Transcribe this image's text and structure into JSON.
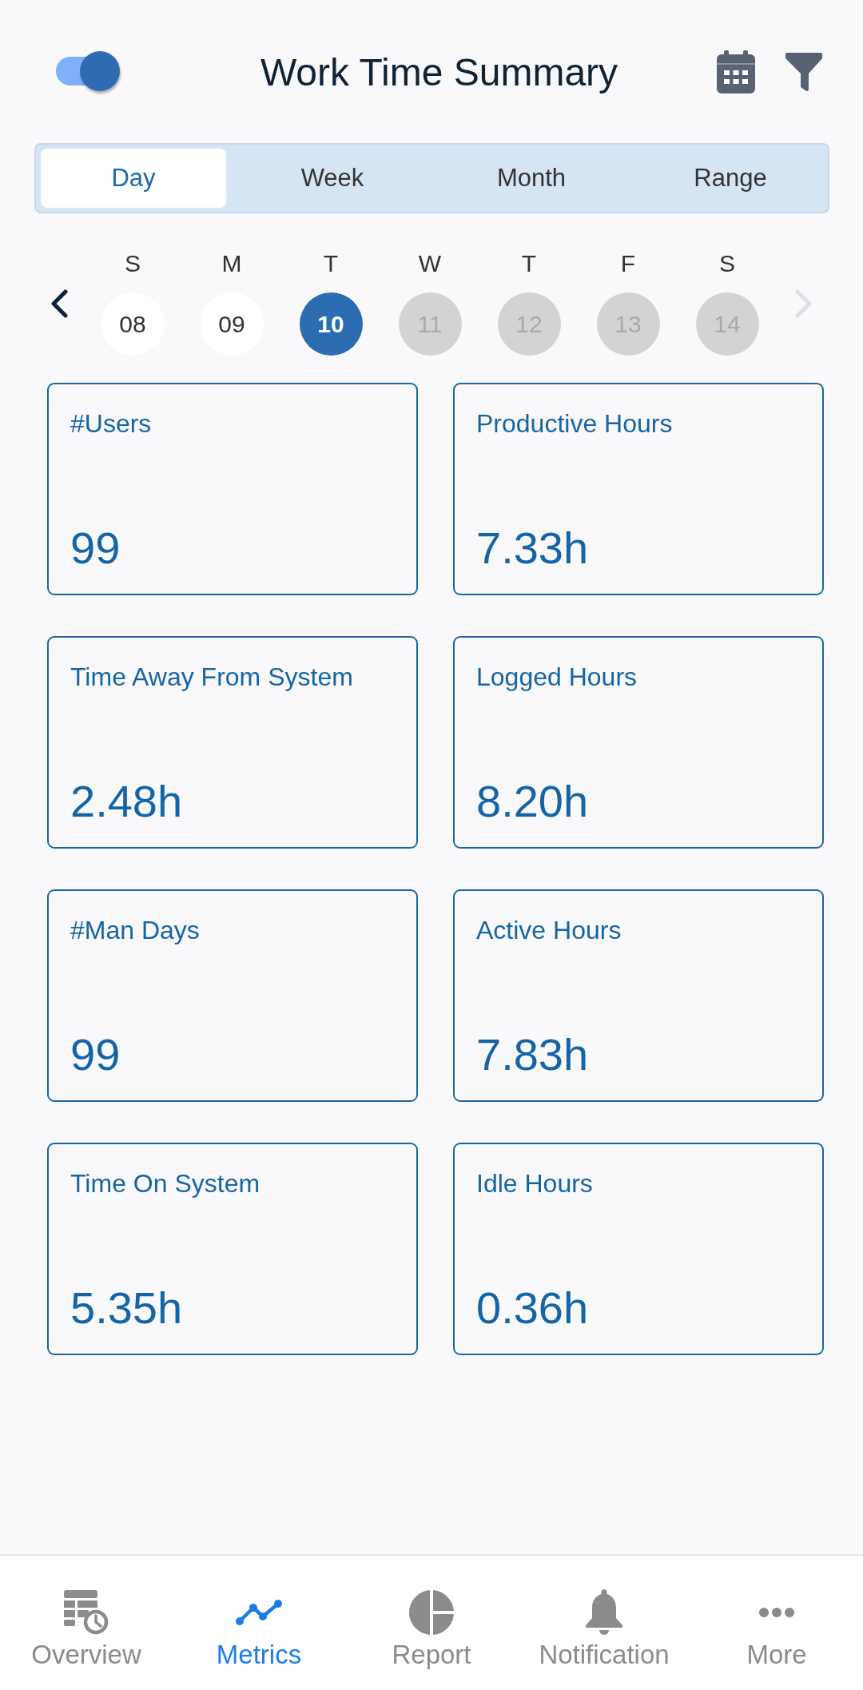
{
  "header": {
    "toggle": {
      "on": true
    },
    "title": "Work Time Summary"
  },
  "period_tabs": [
    {
      "label": "Day",
      "selected": true
    },
    {
      "label": "Week",
      "selected": false
    },
    {
      "label": "Month",
      "selected": false
    },
    {
      "label": "Range",
      "selected": false
    }
  ],
  "week": {
    "previous": {
      "disabled": false
    },
    "next": {
      "disabled": true
    },
    "days": [
      {
        "weekday": "S",
        "date": "08",
        "selected": false,
        "disabled": false
      },
      {
        "weekday": "M",
        "date": "09",
        "selected": false,
        "disabled": false
      },
      {
        "weekday": "T",
        "date": "10",
        "selected": true,
        "disabled": false
      },
      {
        "weekday": "W",
        "date": "11",
        "selected": false,
        "disabled": true
      },
      {
        "weekday": "T",
        "date": "12",
        "selected": false,
        "disabled": true
      },
      {
        "weekday": "F",
        "date": "13",
        "selected": false,
        "disabled": true
      },
      {
        "weekday": "S",
        "date": "14",
        "selected": false,
        "disabled": true
      }
    ]
  },
  "metrics": [
    {
      "label": "#Users",
      "value": "99"
    },
    {
      "label": "Productive Hours",
      "value": "7.33h"
    },
    {
      "label": "Time Away From System",
      "value": "2.48h"
    },
    {
      "label": "Logged Hours",
      "value": "8.20h"
    },
    {
      "label": "#Man Days",
      "value": "99"
    },
    {
      "label": "Active Hours",
      "value": "7.83h"
    },
    {
      "label": "Time On System",
      "value": "5.35h"
    },
    {
      "label": "Idle Hours",
      "value": "0.36h"
    }
  ],
  "bottom_nav": [
    {
      "label": "Overview",
      "selected": false
    },
    {
      "label": "Metrics",
      "selected": true
    },
    {
      "label": "Report",
      "selected": false
    },
    {
      "label": "Notification",
      "selected": false
    },
    {
      "label": "More",
      "selected": false
    }
  ]
}
